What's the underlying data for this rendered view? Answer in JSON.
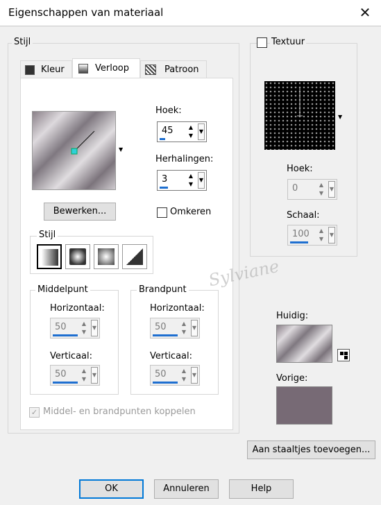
{
  "window": {
    "title": "Eigenschappen van materiaal",
    "close_glyph": "✕"
  },
  "stijl_group": {
    "label": "Stijl"
  },
  "tabs": [
    {
      "label": "Kleur",
      "icon": "color-swatch-icon"
    },
    {
      "label": "Verloop",
      "icon": "gradient-icon"
    },
    {
      "label": "Patroon",
      "icon": "pattern-icon"
    }
  ],
  "gradient": {
    "edit_button": "Bewerken...",
    "hoek_label": "Hoek:",
    "hoek_value": "45",
    "herhalingen_label": "Herhalingen:",
    "herhalingen_value": "3",
    "omkeren_label": "Omkeren",
    "omkeren_checked": false,
    "style_group_label": "Stijl",
    "styles": [
      "linear",
      "rectangular",
      "sunburst",
      "radial"
    ],
    "selected_style": "linear"
  },
  "middelpunt": {
    "label": "Middelpunt",
    "horizontaal_label": "Horizontaal:",
    "horizontaal_value": "50",
    "verticaal_label": "Verticaal:",
    "verticaal_value": "50"
  },
  "brandpunt": {
    "label": "Brandpunt",
    "horizontaal_label": "Horizontaal:",
    "horizontaal_value": "50",
    "verticaal_label": "Verticaal:",
    "verticaal_value": "50"
  },
  "link_label": "Middel- en brandpunten koppelen",
  "link_checked": true,
  "texture": {
    "label": "Textuur",
    "checked": false,
    "hoek_label": "Hoek:",
    "hoek_value": "0",
    "schaal_label": "Schaal:",
    "schaal_value": "100"
  },
  "huidig_label": "Huidig:",
  "vorige_label": "Vorige:",
  "swatch_button": "Aan staaltjes toevoegen...",
  "buttons": {
    "ok": "OK",
    "cancel": "Annuleren",
    "help": "Help"
  },
  "watermark_text": "Sylviane",
  "colors": {
    "accent": "#1e6fd0",
    "vorige": "#776a75",
    "dialog_bg": "#f0f0f0"
  }
}
